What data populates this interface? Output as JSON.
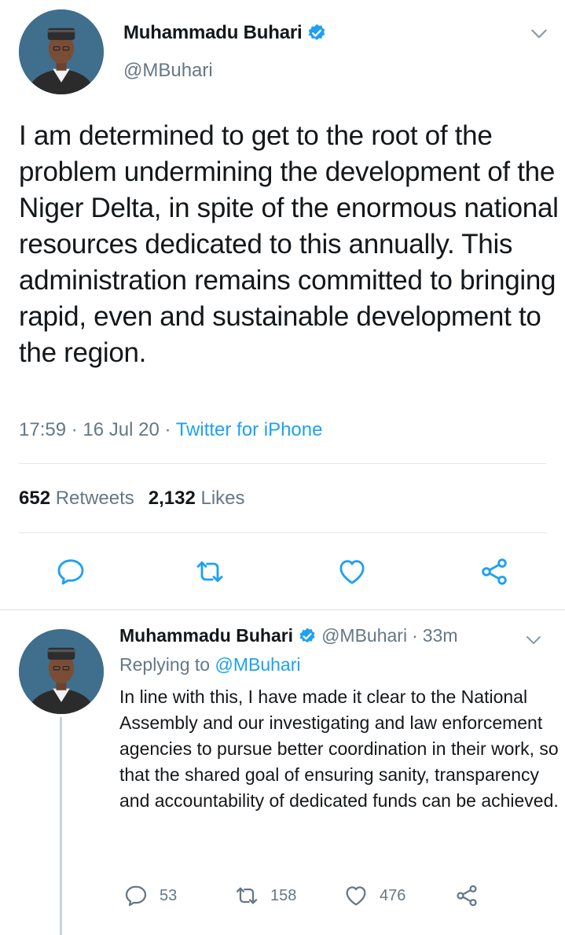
{
  "colors": {
    "link": "#1da1f2",
    "secondary_text": "#657786",
    "primary_text": "#14171a",
    "verified_badge": "#1da1f2",
    "divider": "#e1e8ed"
  },
  "main_tweet": {
    "author_name": "Muhammadu Buhari",
    "author_handle": "@MBuhari",
    "avatar_icon": "profile-photo",
    "verified_icon": "verified-badge-icon",
    "menu_icon": "chevron-down-icon",
    "text": "I am determined to get to the root of the problem undermining the development of the Niger Delta, in spite of the enormous national resources dedicated to this annually. This administration remains committed to bringing rapid, even and sustainable development to the region.",
    "time": "17:59",
    "date": "16 Jul 20",
    "separator": "·",
    "source": "Twitter for iPhone",
    "retweets_count": "652",
    "retweets_label": "Retweets",
    "likes_count": "2,132",
    "likes_label": "Likes",
    "actions": [
      "reply-icon",
      "retweet-icon",
      "like-icon",
      "share-icon"
    ]
  },
  "reply_tweet": {
    "author_name": "Muhammadu Buhari",
    "author_handle": "@MBuhari",
    "time_ago": "33m",
    "separator": "·",
    "replying_to_label": "Replying to",
    "replying_to_handle": "@MBuhari",
    "text": "In line with this, I have made it clear to the National Assembly and our investigating and law enforcement agencies to pursue better coordination in their work, so that the shared goal of ensuring sanity, transparency and accountability of dedicated funds can be achieved.",
    "reply_count": "53",
    "retweet_count": "158",
    "like_count": "476"
  }
}
